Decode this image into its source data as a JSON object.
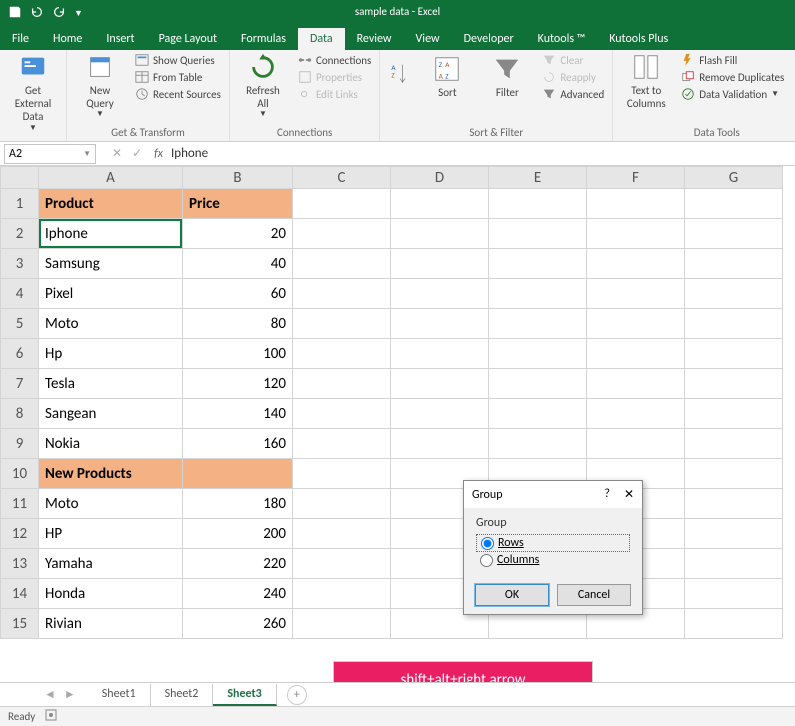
{
  "window_title": "sample data - Excel",
  "tabs": [
    "File",
    "Home",
    "Insert",
    "Page Layout",
    "Formulas",
    "Data",
    "Review",
    "View",
    "Developer",
    "Kutools ™",
    "Kutools Plus"
  ],
  "active_tab": "Data",
  "ribbon": {
    "get_external": "Get External\nData",
    "new_query": "New\nQuery",
    "show_queries": "Show Queries",
    "from_table": "From Table",
    "recent_sources": "Recent Sources",
    "get_transform": "Get & Transform",
    "refresh_all": "Refresh\nAll",
    "connections": "Connections",
    "properties": "Properties",
    "edit_links": "Edit Links",
    "connections_label": "Connections",
    "sort": "Sort",
    "filter": "Filter",
    "clear": "Clear",
    "reapply": "Reapply",
    "advanced": "Advanced",
    "sort_filter": "Sort & Filter",
    "text_columns": "Text to\nColumns",
    "flash_fill": "Flash Fill",
    "remove_dup": "Remove Duplicates",
    "data_validation": "Data Validation",
    "data_tools": "Data Tools"
  },
  "name_box": "A2",
  "fx": "fx",
  "formula": "Iphone",
  "columns": [
    "A",
    "B",
    "C",
    "D",
    "E",
    "F",
    "G"
  ],
  "rows": [
    {
      "n": 1,
      "a": "Product",
      "b": "Price",
      "header": true
    },
    {
      "n": 2,
      "a": "Iphone",
      "b": "20",
      "selected": true
    },
    {
      "n": 3,
      "a": "Samsung",
      "b": "40"
    },
    {
      "n": 4,
      "a": "Pixel",
      "b": "60"
    },
    {
      "n": 5,
      "a": "Moto",
      "b": "80"
    },
    {
      "n": 6,
      "a": "Hp",
      "b": "100"
    },
    {
      "n": 7,
      "a": "Tesla",
      "b": "120"
    },
    {
      "n": 8,
      "a": "Sangean",
      "b": "140"
    },
    {
      "n": 9,
      "a": "Nokia",
      "b": "160"
    },
    {
      "n": 10,
      "a": "New Products",
      "b": "",
      "header": true
    },
    {
      "n": 11,
      "a": "Moto",
      "b": "180"
    },
    {
      "n": 12,
      "a": "HP",
      "b": "200"
    },
    {
      "n": 13,
      "a": "Yamaha",
      "b": "220"
    },
    {
      "n": 14,
      "a": "Honda",
      "b": "240"
    },
    {
      "n": 15,
      "a": "Rivian",
      "b": "260",
      "cut": true
    }
  ],
  "dialog": {
    "title": "Group",
    "help": "?",
    "close": "✕",
    "legend": "Group",
    "rows_label": "Rows",
    "cols_label": "Columns",
    "selected": "rows",
    "ok": "OK",
    "cancel": "Cancel"
  },
  "annotation": "shift+alt+right arrow",
  "sheets": [
    "Sheet1",
    "Sheet2",
    "Sheet3"
  ],
  "active_sheet": "Sheet3",
  "status": "Ready"
}
